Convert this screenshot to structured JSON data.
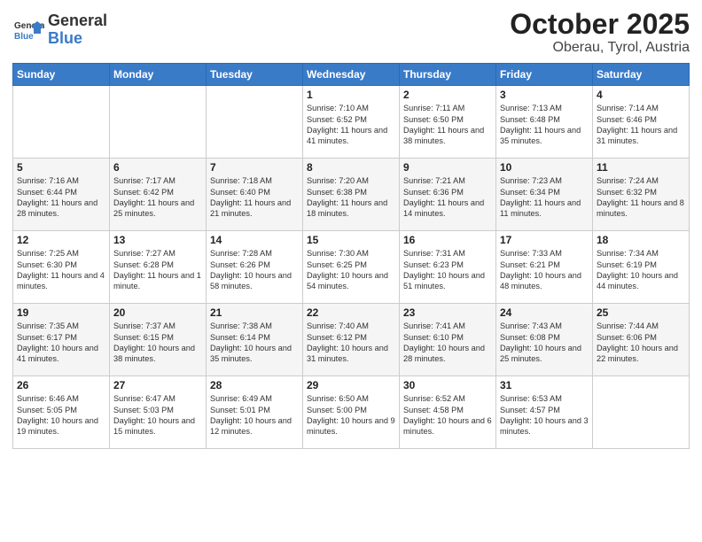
{
  "header": {
    "logo_general": "General",
    "logo_blue": "Blue",
    "title": "October 2025",
    "subtitle": "Oberau, Tyrol, Austria"
  },
  "days_of_week": [
    "Sunday",
    "Monday",
    "Tuesday",
    "Wednesday",
    "Thursday",
    "Friday",
    "Saturday"
  ],
  "weeks": [
    [
      {
        "day": "",
        "info": ""
      },
      {
        "day": "",
        "info": ""
      },
      {
        "day": "",
        "info": ""
      },
      {
        "day": "1",
        "info": "Sunrise: 7:10 AM\nSunset: 6:52 PM\nDaylight: 11 hours and 41 minutes."
      },
      {
        "day": "2",
        "info": "Sunrise: 7:11 AM\nSunset: 6:50 PM\nDaylight: 11 hours and 38 minutes."
      },
      {
        "day": "3",
        "info": "Sunrise: 7:13 AM\nSunset: 6:48 PM\nDaylight: 11 hours and 35 minutes."
      },
      {
        "day": "4",
        "info": "Sunrise: 7:14 AM\nSunset: 6:46 PM\nDaylight: 11 hours and 31 minutes."
      }
    ],
    [
      {
        "day": "5",
        "info": "Sunrise: 7:16 AM\nSunset: 6:44 PM\nDaylight: 11 hours and 28 minutes."
      },
      {
        "day": "6",
        "info": "Sunrise: 7:17 AM\nSunset: 6:42 PM\nDaylight: 11 hours and 25 minutes."
      },
      {
        "day": "7",
        "info": "Sunrise: 7:18 AM\nSunset: 6:40 PM\nDaylight: 11 hours and 21 minutes."
      },
      {
        "day": "8",
        "info": "Sunrise: 7:20 AM\nSunset: 6:38 PM\nDaylight: 11 hours and 18 minutes."
      },
      {
        "day": "9",
        "info": "Sunrise: 7:21 AM\nSunset: 6:36 PM\nDaylight: 11 hours and 14 minutes."
      },
      {
        "day": "10",
        "info": "Sunrise: 7:23 AM\nSunset: 6:34 PM\nDaylight: 11 hours and 11 minutes."
      },
      {
        "day": "11",
        "info": "Sunrise: 7:24 AM\nSunset: 6:32 PM\nDaylight: 11 hours and 8 minutes."
      }
    ],
    [
      {
        "day": "12",
        "info": "Sunrise: 7:25 AM\nSunset: 6:30 PM\nDaylight: 11 hours and 4 minutes."
      },
      {
        "day": "13",
        "info": "Sunrise: 7:27 AM\nSunset: 6:28 PM\nDaylight: 11 hours and 1 minute."
      },
      {
        "day": "14",
        "info": "Sunrise: 7:28 AM\nSunset: 6:26 PM\nDaylight: 10 hours and 58 minutes."
      },
      {
        "day": "15",
        "info": "Sunrise: 7:30 AM\nSunset: 6:25 PM\nDaylight: 10 hours and 54 minutes."
      },
      {
        "day": "16",
        "info": "Sunrise: 7:31 AM\nSunset: 6:23 PM\nDaylight: 10 hours and 51 minutes."
      },
      {
        "day": "17",
        "info": "Sunrise: 7:33 AM\nSunset: 6:21 PM\nDaylight: 10 hours and 48 minutes."
      },
      {
        "day": "18",
        "info": "Sunrise: 7:34 AM\nSunset: 6:19 PM\nDaylight: 10 hours and 44 minutes."
      }
    ],
    [
      {
        "day": "19",
        "info": "Sunrise: 7:35 AM\nSunset: 6:17 PM\nDaylight: 10 hours and 41 minutes."
      },
      {
        "day": "20",
        "info": "Sunrise: 7:37 AM\nSunset: 6:15 PM\nDaylight: 10 hours and 38 minutes."
      },
      {
        "day": "21",
        "info": "Sunrise: 7:38 AM\nSunset: 6:14 PM\nDaylight: 10 hours and 35 minutes."
      },
      {
        "day": "22",
        "info": "Sunrise: 7:40 AM\nSunset: 6:12 PM\nDaylight: 10 hours and 31 minutes."
      },
      {
        "day": "23",
        "info": "Sunrise: 7:41 AM\nSunset: 6:10 PM\nDaylight: 10 hours and 28 minutes."
      },
      {
        "day": "24",
        "info": "Sunrise: 7:43 AM\nSunset: 6:08 PM\nDaylight: 10 hours and 25 minutes."
      },
      {
        "day": "25",
        "info": "Sunrise: 7:44 AM\nSunset: 6:06 PM\nDaylight: 10 hours and 22 minutes."
      }
    ],
    [
      {
        "day": "26",
        "info": "Sunrise: 6:46 AM\nSunset: 5:05 PM\nDaylight: 10 hours and 19 minutes."
      },
      {
        "day": "27",
        "info": "Sunrise: 6:47 AM\nSunset: 5:03 PM\nDaylight: 10 hours and 15 minutes."
      },
      {
        "day": "28",
        "info": "Sunrise: 6:49 AM\nSunset: 5:01 PM\nDaylight: 10 hours and 12 minutes."
      },
      {
        "day": "29",
        "info": "Sunrise: 6:50 AM\nSunset: 5:00 PM\nDaylight: 10 hours and 9 minutes."
      },
      {
        "day": "30",
        "info": "Sunrise: 6:52 AM\nSunset: 4:58 PM\nDaylight: 10 hours and 6 minutes."
      },
      {
        "day": "31",
        "info": "Sunrise: 6:53 AM\nSunset: 4:57 PM\nDaylight: 10 hours and 3 minutes."
      },
      {
        "day": "",
        "info": ""
      }
    ]
  ]
}
